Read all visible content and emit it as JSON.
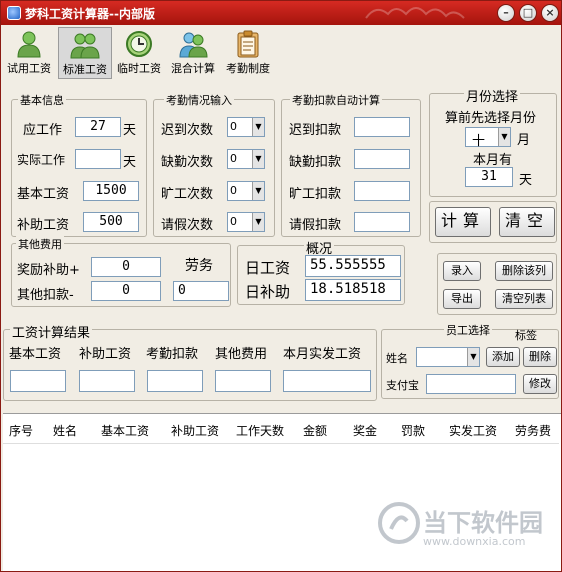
{
  "window": {
    "title": "梦科工资计算器--内部版"
  },
  "toolbar": [
    {
      "label": "试用工资",
      "icon": "user-icon"
    },
    {
      "label": "标准工资",
      "icon": "users-icon",
      "active": true
    },
    {
      "label": "临时工资",
      "icon": "clock-icon"
    },
    {
      "label": "混合计算",
      "icon": "people-mix-icon"
    },
    {
      "label": "考勤制度",
      "icon": "clipboard-icon"
    }
  ],
  "basic_info": {
    "title": "基本信息",
    "due_work_label": "应工作",
    "due_work_value": "27",
    "due_work_unit": "天",
    "actual_work_label": "实际工作",
    "actual_work_value": "",
    "actual_work_unit": "天",
    "base_salary_label": "基本工资",
    "base_salary_value": "1500",
    "subsidy_label": "补助工资",
    "subsidy_value": "500"
  },
  "attendance_input": {
    "title": "考勤情况输入",
    "late_label": "迟到次数",
    "late_value": "0",
    "absent_label": "缺勤次数",
    "absent_value": "0",
    "truant_label": "旷工次数",
    "truant_value": "0",
    "leave_label": "请假次数",
    "leave_value": "0"
  },
  "attendance_deduct": {
    "title": "考勤扣款自动计算",
    "late_label": "迟到扣款",
    "absent_label": "缺勤扣款",
    "truant_label": "旷工扣款",
    "leave_label": "请假扣款"
  },
  "month_select": {
    "title": "月份选择",
    "hint": "算前先选择月份",
    "month_value": "十",
    "month_unit": "月",
    "days_label": "本月有",
    "days_value": "31",
    "days_unit": "天"
  },
  "actions": {
    "calc_label": "计算",
    "clear_label": "清空"
  },
  "other_fees": {
    "title": "其他费用",
    "bonus_label": "奖励补助+",
    "bonus_value": "0",
    "deduct_label": "其他扣款-",
    "deduct_value": "0",
    "labor_label": "劳务",
    "labor_value": "0"
  },
  "overview": {
    "title": "概况",
    "daily_label": "日工资",
    "daily_value": "55.555555",
    "daily_sub_label": "日补助",
    "daily_sub_value": "18.518518"
  },
  "record_buttons": {
    "enter": "录入",
    "delete_col": "删除该列",
    "export": "导出",
    "clear_list": "清空列表"
  },
  "results": {
    "title": "工资计算结果",
    "cols": [
      "基本工资",
      "补助工资",
      "考勤扣款",
      "其他费用",
      "本月实发工资"
    ]
  },
  "employee": {
    "title": "员工选择",
    "tag_label": "标签",
    "name_label": "姓名",
    "add_label": "添加",
    "delete_label": "删除",
    "alipay_label": "支付宝",
    "edit_label": "修改"
  },
  "table": {
    "headers": [
      "序号",
      "姓名",
      "基本工资",
      "补助工资",
      "工作天数",
      "金额",
      "奖金",
      "罚款",
      "实发工资",
      "劳务费"
    ]
  },
  "watermark": {
    "text": "当下软件园",
    "url": "www.downxia.com"
  }
}
